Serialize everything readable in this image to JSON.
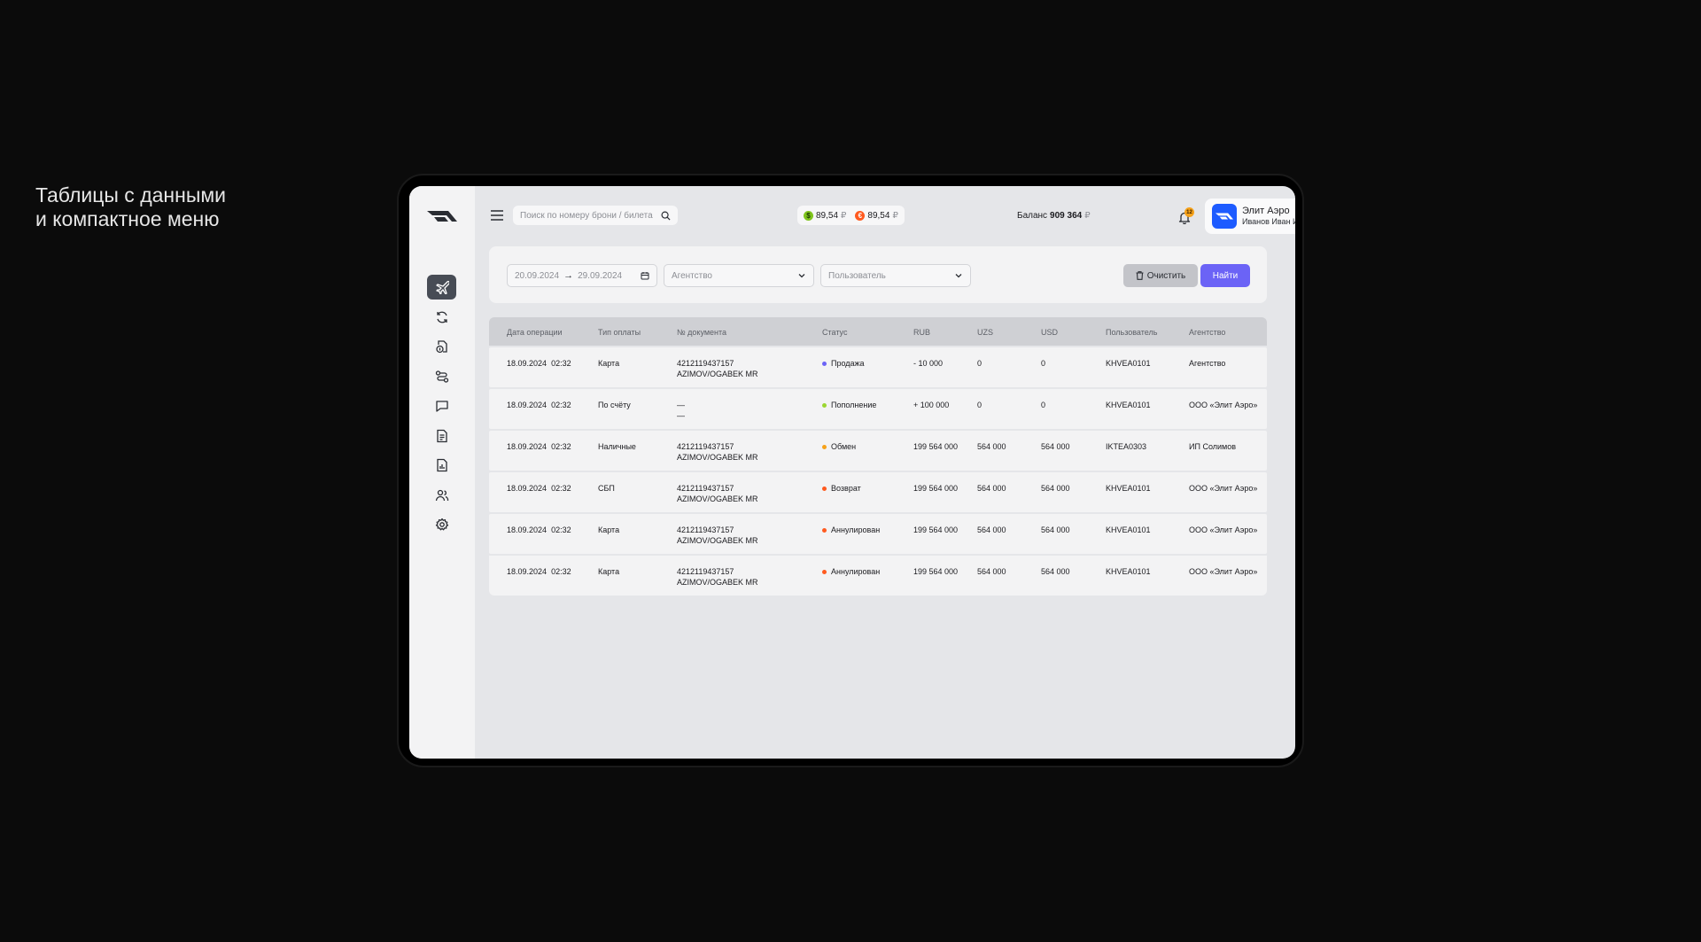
{
  "caption": {
    "line1": "Таблицы с данными",
    "line2": "и компактное меню"
  },
  "header": {
    "search_placeholder": "Поиск по номеру брони / билета",
    "rates": [
      {
        "symbol": "$",
        "value": "89,54",
        "currency": "₽",
        "color": "#7fc41d"
      },
      {
        "symbol": "€",
        "value": "89,54",
        "currency": "₽",
        "color": "#ff5a1f"
      }
    ],
    "balance_label": "Баланс",
    "balance_value": "909 364",
    "balance_currency": "₽",
    "notifications_count": "12",
    "account_name": "Элит Аэро",
    "account_user": "Иванов Иван И."
  },
  "sidebar": {
    "items": [
      {
        "icon": "airplane-icon",
        "active": true
      },
      {
        "icon": "refresh-icon"
      },
      {
        "icon": "document-money-icon"
      },
      {
        "icon": "route-icon"
      },
      {
        "icon": "chat-icon"
      },
      {
        "icon": "invoice-icon"
      },
      {
        "icon": "report-icon"
      },
      {
        "icon": "users-icon"
      },
      {
        "icon": "gear-icon"
      }
    ]
  },
  "filters": {
    "date_from": "20.09.2024",
    "date_to": "29.09.2024",
    "agency_placeholder": "Агентство",
    "user_placeholder": "Пользователь",
    "clear_label": "Очистить",
    "find_label": "Найти"
  },
  "table": {
    "columns": [
      "Дата операции",
      "Тип оплаты",
      "№ документа",
      "Статус",
      "RUB",
      "UZS",
      "USD",
      "Пользователь",
      "Агентство"
    ],
    "rows": [
      {
        "date": "18.09.2024",
        "time": "02:32",
        "payment": "Карта",
        "doc1": "4212119437157",
        "doc2": "AZIMOV/OGABEK MR",
        "status": "Продажа",
        "status_color": "#6b63f6",
        "rub": "- 10 000",
        "uzs": "0",
        "usd": "0",
        "user": "KHVEA0101",
        "agency": "Агентство"
      },
      {
        "date": "18.09.2024",
        "time": "02:32",
        "payment": "По счёту",
        "doc1": "—",
        "doc2": "—",
        "status": "Пополнение",
        "status_color": "#9bd631",
        "rub": "+ 100 000",
        "uzs": "0",
        "usd": "0",
        "user": "KHVEA0101",
        "agency": "ООО «Элит Аэро»"
      },
      {
        "date": "18.09.2024",
        "time": "02:32",
        "payment": "Наличные",
        "doc1": "4212119437157",
        "doc2": "AZIMOV/OGABEK MR",
        "status": "Обмен",
        "status_color": "#f6a21a",
        "rub": "199 564 000",
        "uzs": "564 000",
        "usd": "564 000",
        "user": "IKTEA0303",
        "agency": "ИП Солимов"
      },
      {
        "date": "18.09.2024",
        "time": "02:32",
        "payment": "СБП",
        "doc1": "4212119437157",
        "doc2": "AZIMOV/OGABEK MR",
        "status": "Возврат",
        "status_color": "#ff5a1f",
        "rub": "199 564 000",
        "uzs": "564 000",
        "usd": "564 000",
        "user": "KHVEA0101",
        "agency": "ООО «Элит Аэро»"
      },
      {
        "date": "18.09.2024",
        "time": "02:32",
        "payment": "Карта",
        "doc1": "4212119437157",
        "doc2": "AZIMOV/OGABEK MR",
        "status": "Аннулирован",
        "status_color": "#ff5a1f",
        "rub": "199 564 000",
        "uzs": "564 000",
        "usd": "564 000",
        "user": "KHVEA0101",
        "agency": "ООО «Элит Аэро»"
      },
      {
        "date": "18.09.2024",
        "time": "02:32",
        "payment": "Карта",
        "doc1": "4212119437157",
        "doc2": "AZIMOV/OGABEK MR",
        "status": "Аннулирован",
        "status_color": "#ff5a1f",
        "rub": "199 564 000",
        "uzs": "564 000",
        "usd": "564 000",
        "user": "KHVEA0101",
        "agency": "ООО «Элит Аэро»"
      }
    ]
  }
}
